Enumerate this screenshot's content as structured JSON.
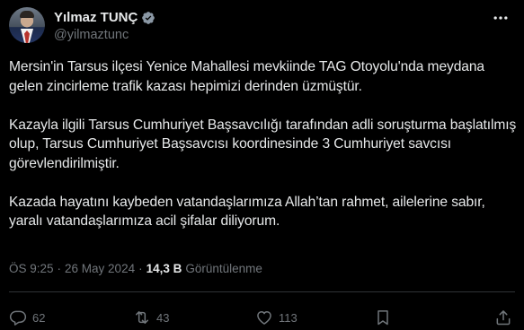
{
  "author": {
    "display_name": "Yılmaz TUNÇ",
    "handle": "@yilmaztunc",
    "verified": true,
    "verified_color": "#8b98a5"
  },
  "tweet": {
    "paragraphs": [
      "Mersin'in Tarsus ilçesi Yenice Mahallesi mevkiinde TAG Otoyolu'nda meydana gelen zincirleme trafik kazası hepimizi derinden üzmüştür.",
      "Kazayla ilgili Tarsus Cumhuriyet Başsavcılığı tarafından adli soruşturma başlatılmış olup, Tarsus Cumhuriyet Başsavcısı koordinesinde 3 Cumhuriyet savcısı görevlendirilmiştir.",
      "Kazada hayatını kaybeden vatandaşlarımıza Allah’tan rahmet, ailelerine sabır, yaralı vatandaşlarımıza acil şifalar diliyorum."
    ],
    "time": "ÖS 9:25",
    "separator": "·",
    "date": "26 May 2024",
    "views_count": "14,3 B",
    "views_label": "Görüntülenme"
  },
  "actions": {
    "replies": "62",
    "reposts": "43",
    "likes": "113"
  },
  "icons": {
    "more": "more-horizontal-icon",
    "reply": "reply-icon",
    "repost": "repost-icon",
    "like": "heart-icon",
    "bookmark": "bookmark-icon",
    "share": "share-icon"
  },
  "colors": {
    "background": "#000000",
    "text": "#e7e9ea",
    "muted": "#71767b",
    "divider": "#2f3336"
  }
}
